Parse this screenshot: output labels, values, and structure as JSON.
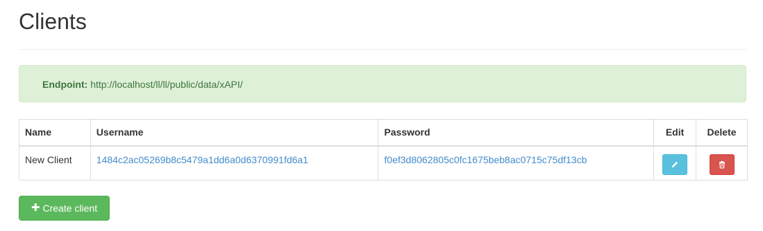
{
  "header": {
    "title": "Clients"
  },
  "alert": {
    "label": "Endpoint:",
    "value": "http://localhost/ll/ll/public/data/xAPI/"
  },
  "table": {
    "columns": {
      "name": "Name",
      "username": "Username",
      "password": "Password",
      "edit": "Edit",
      "delete": "Delete"
    },
    "rows": [
      {
        "name": "New Client",
        "username": "1484c2ac05269b8c5479a1dd6a0d6370991fd6a1",
        "password": "f0ef3d8062805c0fc1675beb8ac0715c75df13cb",
        "edit_icon": "pencil-icon",
        "delete_icon": "trash-icon"
      }
    ]
  },
  "actions": {
    "create_plus": "✚",
    "create_label": "Create client"
  },
  "colors": {
    "link": "#428bca",
    "alert_bg": "#dff0d8",
    "alert_text": "#3c763d",
    "edit_button": "#5bc0de",
    "delete_button": "#d9534f",
    "create_button": "#5cb85c"
  }
}
